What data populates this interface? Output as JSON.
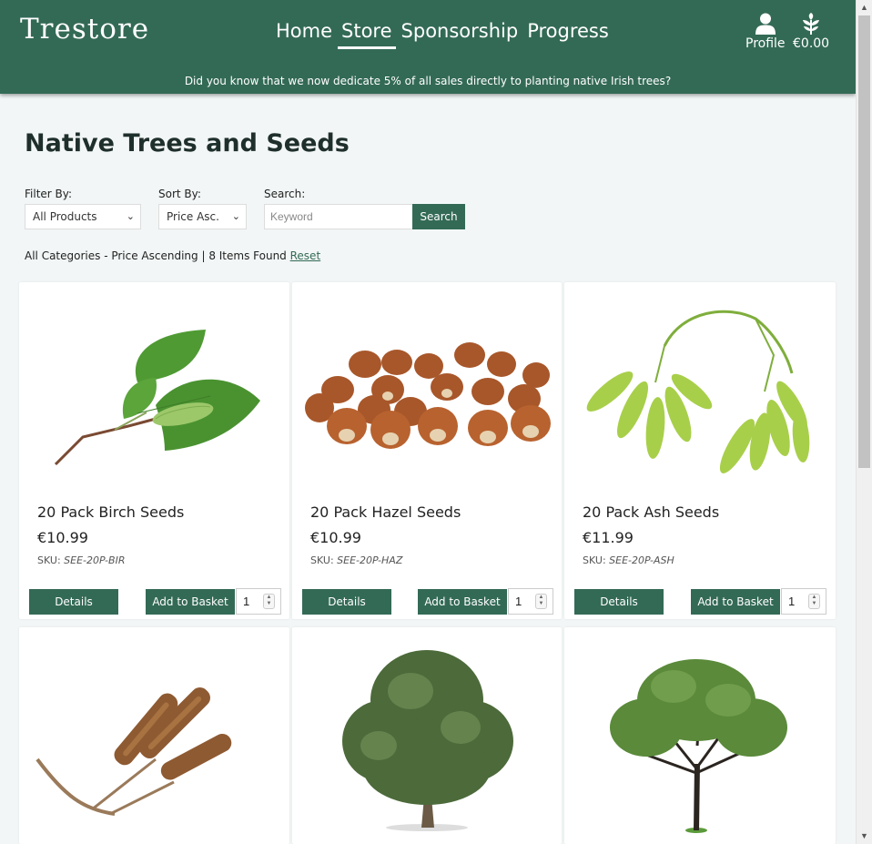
{
  "header": {
    "logo": "Trestore",
    "nav": [
      "Home",
      "Store",
      "Sponsorship",
      "Progress"
    ],
    "active_nav": "Store",
    "profile_label": "Profile",
    "basket_total": "€0.00",
    "banner": "Did you know that we now dedicate 5% of all sales directly to planting native Irish trees?"
  },
  "page": {
    "title": "Native Trees and Seeds"
  },
  "controls": {
    "filter_label": "Filter By:",
    "filter_value": "All Products",
    "sort_label": "Sort By:",
    "sort_value": "Price Asc.",
    "search_label": "Search:",
    "search_placeholder": "Keyword",
    "search_button": "Search"
  },
  "results": {
    "summary": "All Categories - Price Ascending | 8 Items Found",
    "reset_label": "Reset"
  },
  "card_buttons": {
    "details": "Details",
    "add": "Add to Basket"
  },
  "products": [
    {
      "name": "20 Pack Birch Seeds",
      "price": "€10.99",
      "sku_label": "SKU:",
      "sku": "SEE-20P-BIR",
      "qty": "1",
      "image": "birch-catkin-leaves"
    },
    {
      "name": "20 Pack Hazel Seeds",
      "price": "€10.99",
      "sku_label": "SKU:",
      "sku": "SEE-20P-HAZ",
      "qty": "1",
      "image": "hazelnuts"
    },
    {
      "name": "20 Pack Ash Seeds",
      "price": "€11.99",
      "sku_label": "SKU:",
      "sku": "SEE-20P-ASH",
      "qty": "1",
      "image": "ash-keys"
    },
    {
      "image": "alder-catkins"
    },
    {
      "image": "bushy-tree"
    },
    {
      "image": "open-crown-tree"
    }
  ],
  "colors": {
    "brand": "#336a56",
    "background": "#f2f6f6"
  }
}
